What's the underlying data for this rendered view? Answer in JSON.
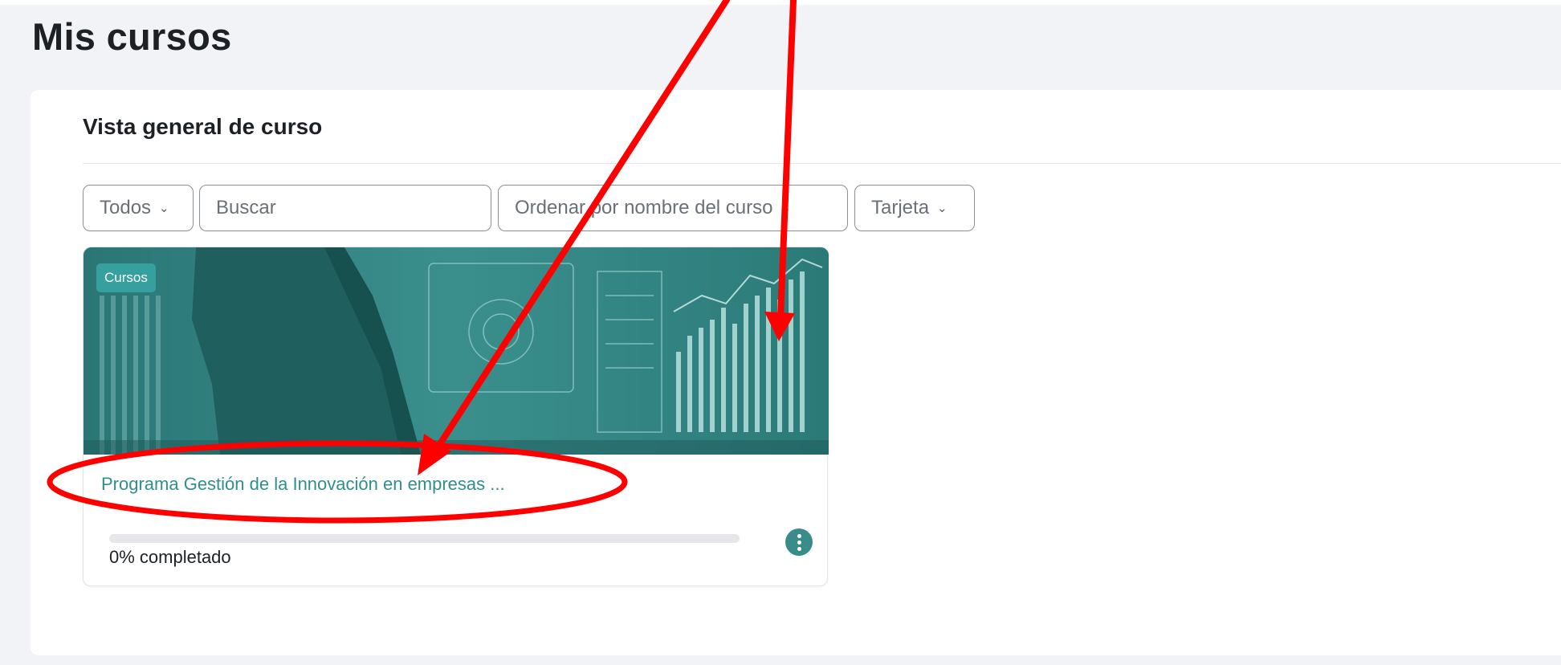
{
  "page": {
    "title": "Mis cursos"
  },
  "overview": {
    "title": "Vista general de curso",
    "filter": {
      "label": "Todos",
      "icon": "chevron-down-icon"
    },
    "search": {
      "placeholder": "Buscar",
      "value": ""
    },
    "sort": {
      "label": "Ordenar por nombre del curso",
      "icon": "chevron-down-icon"
    },
    "view": {
      "label": "Tarjeta",
      "icon": "chevron-down-icon"
    }
  },
  "course": {
    "category": "Cursos",
    "name": "Programa Gestión de la Innovación en empresas ...",
    "progress_percent": 0,
    "progress_text": "0% completado",
    "menu_icon": "vertical-ellipsis-icon"
  },
  "colors": {
    "accent": "#2f8f8d",
    "annotation": "#ff0000"
  }
}
